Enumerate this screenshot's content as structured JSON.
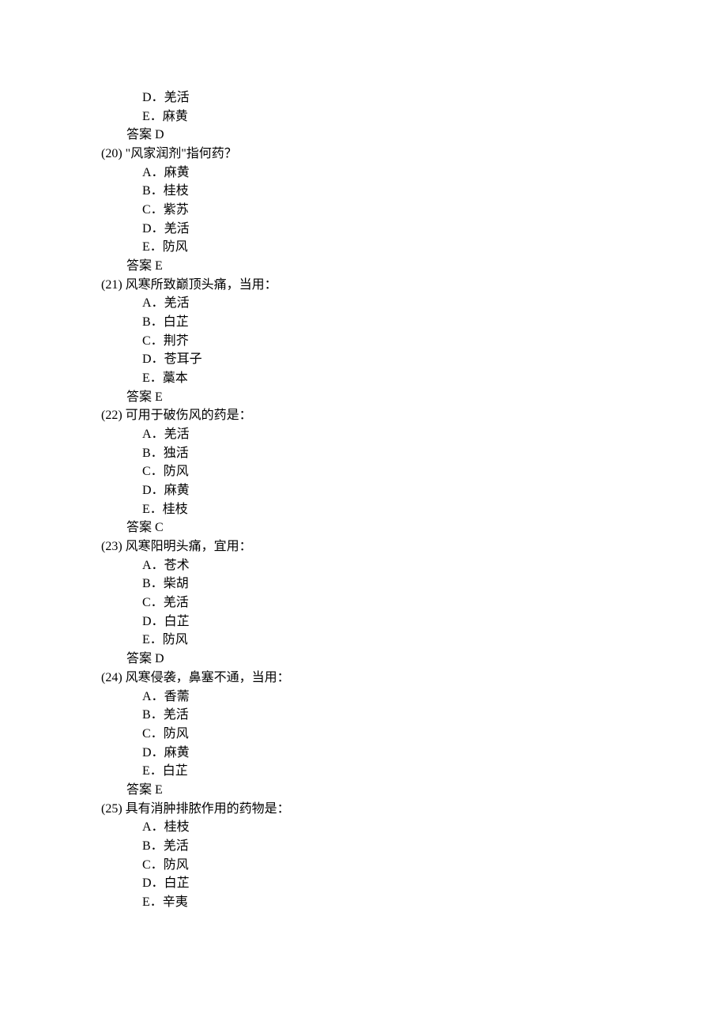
{
  "leading_options": [
    {
      "letter": "D．",
      "text": "羌活"
    },
    {
      "letter": "E．",
      "text": "麻黄"
    }
  ],
  "leading_answer": {
    "label": "答案",
    "value": " D"
  },
  "questions": [
    {
      "num": "(20) ",
      "text": "\"风家润剂\"指何药？",
      "options": [
        {
          "letter": "A．",
          "text": "麻黄"
        },
        {
          "letter": "B．",
          "text": "桂枝"
        },
        {
          "letter": "C．",
          "text": "紫苏"
        },
        {
          "letter": "D．",
          "text": "羌活"
        },
        {
          "letter": "E．",
          "text": "防风"
        }
      ],
      "answer": {
        "label": "答案",
        "value": " E"
      }
    },
    {
      "num": "(21) ",
      "text": "风寒所致巅顶头痛，当用：",
      "options": [
        {
          "letter": "A．",
          "text": "羌活"
        },
        {
          "letter": "B．",
          "text": "白芷"
        },
        {
          "letter": "C．",
          "text": "荆芥"
        },
        {
          "letter": "D．",
          "text": "苍耳子"
        },
        {
          "letter": "E．",
          "text": "藁本"
        }
      ],
      "answer": {
        "label": "答案",
        "value": " E"
      }
    },
    {
      "num": "(22) ",
      "text": "可用于破伤风的药是：",
      "options": [
        {
          "letter": "A．",
          "text": "羌活"
        },
        {
          "letter": "B．",
          "text": "独活"
        },
        {
          "letter": "C．",
          "text": "防风"
        },
        {
          "letter": "D．",
          "text": "麻黄"
        },
        {
          "letter": "E．",
          "text": "桂枝"
        }
      ],
      "answer": {
        "label": "答案",
        "value": " C"
      }
    },
    {
      "num": "(23) ",
      "text": "风寒阳明头痛，宜用：",
      "options": [
        {
          "letter": "A．",
          "text": "苍术"
        },
        {
          "letter": "B．",
          "text": "柴胡"
        },
        {
          "letter": "C．",
          "text": "羌活"
        },
        {
          "letter": "D．",
          "text": "白芷"
        },
        {
          "letter": "E．",
          "text": "防风"
        }
      ],
      "answer": {
        "label": "答案",
        "value": " D"
      }
    },
    {
      "num": "(24) ",
      "text": "风寒侵袭，鼻塞不通，当用：",
      "options": [
        {
          "letter": "A．",
          "text": "香薷"
        },
        {
          "letter": "B．",
          "text": "羌活"
        },
        {
          "letter": "C．",
          "text": "防风"
        },
        {
          "letter": "D．",
          "text": "麻黄"
        },
        {
          "letter": "E．",
          "text": "白芷"
        }
      ],
      "answer": {
        "label": "答案",
        "value": " E"
      }
    },
    {
      "num": "(25) ",
      "text": "具有消肿排脓作用的药物是：",
      "options": [
        {
          "letter": "A．",
          "text": "桂枝"
        },
        {
          "letter": "B．",
          "text": "羌活"
        },
        {
          "letter": "C．",
          "text": "防风"
        },
        {
          "letter": "D．",
          "text": "白芷"
        },
        {
          "letter": "E．",
          "text": "辛夷"
        }
      ],
      "answer": null
    }
  ]
}
